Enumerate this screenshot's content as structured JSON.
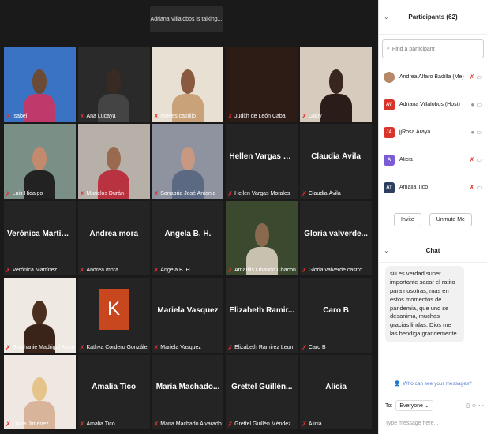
{
  "talking_banner": "Adriana Villalobos is talking...",
  "tiles": [
    {
      "caption": "Isabel",
      "display": ""
    },
    {
      "caption": "Ana Lucaya",
      "display": ""
    },
    {
      "caption": "Nieves castillo",
      "display": ""
    },
    {
      "caption": "Judith de León Caba",
      "display": ""
    },
    {
      "caption": "Gaby",
      "display": ""
    },
    {
      "caption": "Luis Hidalgo",
      "display": ""
    },
    {
      "caption": "Marielos Durán",
      "display": ""
    },
    {
      "caption": "Sanabria José Antonio",
      "display": ""
    },
    {
      "caption": "Hellen Vargas Morales",
      "display": "Hellen Vargas M..."
    },
    {
      "caption": "Claudia Ávila",
      "display": "Claudia Ávila"
    },
    {
      "caption": "Verónica Martínez",
      "display": "Verónica Martínez"
    },
    {
      "caption": "Andrea mora",
      "display": "Andrea mora"
    },
    {
      "caption": "Ángela B. H.",
      "display": "Ángela B. H."
    },
    {
      "caption": "Amarilis Obando Chacon",
      "display": ""
    },
    {
      "caption": "Gloria valverde castro",
      "display": "Gloria valverde..."
    },
    {
      "caption": "Stephanie Madrigal Argue...",
      "display": ""
    },
    {
      "caption": "Kathya Cordero González",
      "display": ""
    },
    {
      "caption": "Mariela Vasquez",
      "display": "Mariela Vasquez"
    },
    {
      "caption": "Elizabeth Ramirez Leon",
      "display": "Elizabeth Ramir..."
    },
    {
      "caption": "Caro B",
      "display": "Caro B"
    },
    {
      "caption": "Laura Jiménez",
      "display": ""
    },
    {
      "caption": "Amalia Tico",
      "display": "Amalia Tico"
    },
    {
      "caption": "Maria Machado Alvarado",
      "display": "Maria Machado..."
    },
    {
      "caption": "Grettel Guillén Méndez",
      "display": "Grettel Guillén..."
    },
    {
      "caption": "Alicia",
      "display": "Alicia"
    }
  ],
  "kathya_initial": "K",
  "participants": {
    "title": "Participants (62)",
    "search_placeholder": "Find a participant",
    "list": [
      {
        "initials": "",
        "name": "Andrea Alfaro Badilla (Me)",
        "color": "#b7876a"
      },
      {
        "initials": "AV",
        "name": "Adriana Villalobos (Host)",
        "color": "#d9342b"
      },
      {
        "initials": "JA",
        "name": "jjRosa Araya",
        "color": "#d9342b"
      },
      {
        "initials": "A",
        "name": "Alicia",
        "color": "#7b5cd6"
      },
      {
        "initials": "AT",
        "name": "Amalia Tico",
        "color": "#2d3f5e"
      }
    ],
    "invite_label": "Invite",
    "unmute_label": "Unmute Me"
  },
  "chat": {
    "title": "Chat",
    "message": "siii es verdad super importante sacar el ratito para nosotras, mas en estos momentos de pandemia, que uno se desanima, muchas gracias lindas, Dios me las bendiga grandemente",
    "who_can_see": "Who can see your messages?",
    "to_label": "To:",
    "to_value": "Everyone",
    "placeholder": "Type message here..."
  },
  "colors": {
    "accent": "#0e72ed",
    "muted_red": "#e0302e",
    "kathya_tile": "#c9471f"
  }
}
